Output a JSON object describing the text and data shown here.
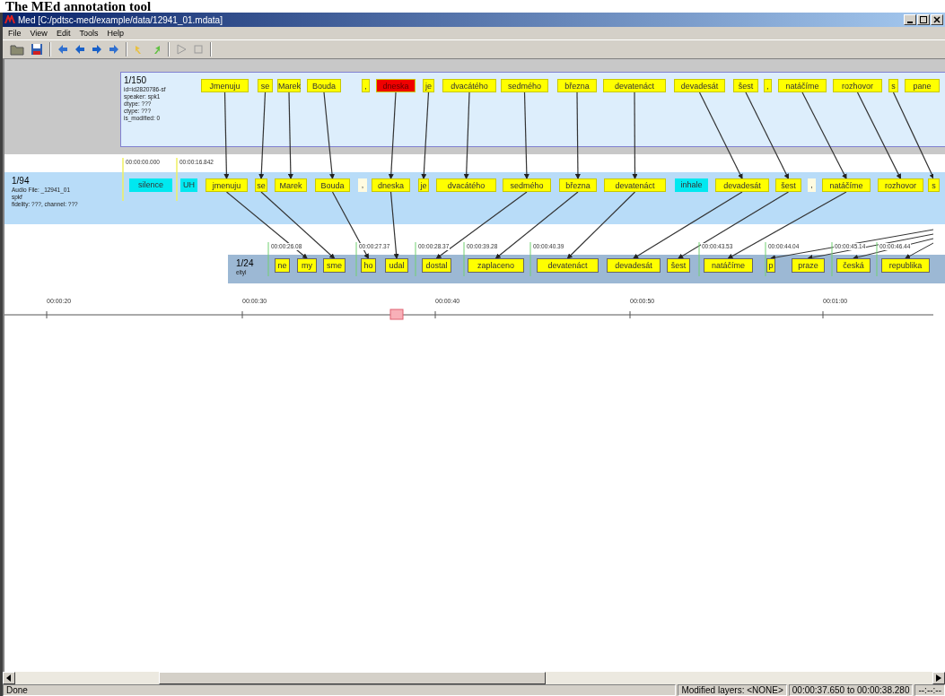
{
  "page_title": "The MEd annotation tool",
  "window": {
    "title": "Med [C:/pdtsc-med/example/data/12941_01.mdata]"
  },
  "menu": [
    "File",
    "View",
    "Edit",
    "Tools",
    "Help"
  ],
  "layers": [
    {
      "header": [
        "1/150",
        "id=id2820786-sf",
        "speaker: spk1",
        "dtype: ???",
        "ctype: ???",
        "is_modified: 0"
      ],
      "tokens": [
        {
          "text": "Jmenuju",
          "kind": "word",
          "selected": false
        },
        {
          "text": "se",
          "kind": "word",
          "selected": false
        },
        {
          "text": "Marek",
          "kind": "word",
          "selected": false
        },
        {
          "text": "Bouda",
          "kind": "word",
          "selected": false
        },
        {
          "text": ",",
          "kind": "word",
          "selected": false
        },
        {
          "text": "dneska",
          "kind": "word",
          "selected": true
        },
        {
          "text": "je",
          "kind": "word",
          "selected": false
        },
        {
          "text": "dvacátého",
          "kind": "word",
          "selected": false
        },
        {
          "text": "sedmého",
          "kind": "word",
          "selected": false
        },
        {
          "text": "března",
          "kind": "word",
          "selected": false
        },
        {
          "text": "devatenáct",
          "kind": "word",
          "selected": false
        },
        {
          "text": "devadesát",
          "kind": "word",
          "selected": false
        },
        {
          "text": "šest",
          "kind": "word",
          "selected": false
        },
        {
          "text": ",",
          "kind": "word",
          "selected": false
        },
        {
          "text": "natáčíme",
          "kind": "word",
          "selected": false
        },
        {
          "text": "rozhovor",
          "kind": "word",
          "selected": false
        },
        {
          "text": "s",
          "kind": "word",
          "selected": false
        },
        {
          "text": "pane",
          "kind": "word",
          "selected": false
        }
      ]
    },
    {
      "header": [
        "1/94",
        "Audio File: _12941_01",
        "spkf",
        "fidelity: ???, channel: ???"
      ],
      "time_marks": [
        "00:00:00.000",
        "00:00:16.842"
      ],
      "tokens": [
        {
          "text": "silence",
          "kind": "event",
          "selected": false
        },
        {
          "text": "UH",
          "kind": "event",
          "selected": false
        },
        {
          "text": "jmenuju",
          "kind": "word",
          "selected": false
        },
        {
          "text": "se",
          "kind": "word",
          "selected": false
        },
        {
          "text": "Marek",
          "kind": "word",
          "selected": false
        },
        {
          "text": "Bouda",
          "kind": "word",
          "selected": false
        },
        {
          "text": ",",
          "kind": "punct",
          "selected": false
        },
        {
          "text": "dneska",
          "kind": "word",
          "selected": false
        },
        {
          "text": "je",
          "kind": "word",
          "selected": false
        },
        {
          "text": "dvacátého",
          "kind": "word",
          "selected": false
        },
        {
          "text": "sedmého",
          "kind": "word",
          "selected": false
        },
        {
          "text": "března",
          "kind": "word",
          "selected": false
        },
        {
          "text": "devatenáct",
          "kind": "word",
          "selected": false
        },
        {
          "text": "inhale",
          "kind": "event",
          "selected": false
        },
        {
          "text": "devadesát",
          "kind": "word",
          "selected": false
        },
        {
          "text": "šest",
          "kind": "word",
          "selected": false
        },
        {
          "text": ",",
          "kind": "punct",
          "selected": false
        },
        {
          "text": "natáčíme",
          "kind": "word",
          "selected": false
        },
        {
          "text": "rozhovor",
          "kind": "word",
          "selected": false
        },
        {
          "text": "s",
          "kind": "word",
          "selected": false
        }
      ]
    },
    {
      "header": [
        "1/24",
        "eltyl"
      ],
      "time_marks": [
        "00:00:26.08",
        "00:00:27.37",
        "00:00:28.37",
        "00:00:39.28",
        "00:00:40.39",
        "00:00:43.53",
        "00:00:44.04",
        "00:00:45.14",
        "00:00:46.44"
      ],
      "tokens": [
        {
          "text": "ne",
          "kind": "word",
          "selected": false,
          "linked_from_right": false
        },
        {
          "text": "my",
          "kind": "word",
          "selected": false,
          "linked_from_right": false
        },
        {
          "text": "sme",
          "kind": "word",
          "selected": false,
          "linked_from_right": false
        },
        {
          "text": "ho",
          "kind": "word",
          "selected": false,
          "linked_from_right": false
        },
        {
          "text": "udal",
          "kind": "word",
          "selected": false,
          "linked_from_right": false
        },
        {
          "text": "dostal",
          "kind": "word",
          "selected": false,
          "linked_from_right": false
        },
        {
          "text": "zaplaceno",
          "kind": "word",
          "selected": false,
          "linked_from_right": false
        },
        {
          "text": "devatenáct",
          "kind": "word",
          "selected": false,
          "linked_from_right": false
        },
        {
          "text": "devadesát",
          "kind": "word",
          "selected": false,
          "linked_from_right": false
        },
        {
          "text": "šest",
          "kind": "word",
          "selected": false,
          "linked_from_right": false
        },
        {
          "text": "natáčíme",
          "kind": "word",
          "selected": false,
          "linked_from_right": false
        },
        {
          "text": "p",
          "kind": "word",
          "selected": false,
          "linked_from_right": true
        },
        {
          "text": "praze",
          "kind": "word",
          "selected": false,
          "linked_from_right": true
        },
        {
          "text": "česká",
          "kind": "word",
          "selected": false,
          "linked_from_right": true
        },
        {
          "text": "republika",
          "kind": "word",
          "selected": false,
          "linked_from_right": true
        }
      ]
    }
  ],
  "timeline": {
    "labels": [
      "00:00:20",
      "00:00:30",
      "00:00:40",
      "00:00:50",
      "00:01:00"
    ]
  },
  "status_bar": {
    "message": "Done",
    "modified": "Modified layers: <NONE>",
    "range": "00:00:37.650 to 00:00:38.280",
    "time": "--:--:--"
  }
}
